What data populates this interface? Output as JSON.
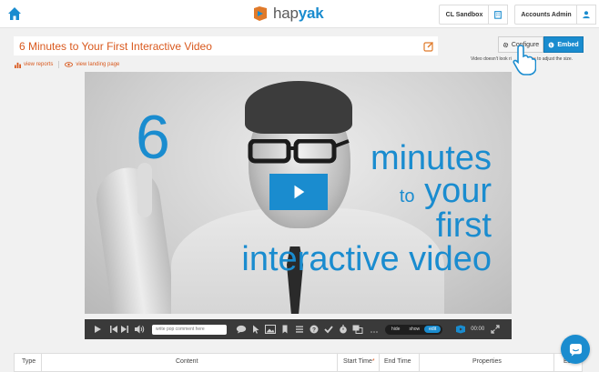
{
  "header": {
    "logo_text_hap": "hap",
    "logo_text_yak": "yak",
    "sandbox_label": "CL Sandbox",
    "account_label": "Accounts Admin"
  },
  "page": {
    "title": "6 Minutes to Your First Interactive Video",
    "links": [
      "view reports",
      "view landing page"
    ]
  },
  "actions": {
    "configure_label": "Configure",
    "embed_label": "Embed",
    "notice_prefix": "Video doesn't look ri",
    "notice_link": "here",
    "notice_suffix": " to adjust the size."
  },
  "video": {
    "big_number": "6",
    "line1": "minutes",
    "line2_small": "to",
    "line2_big": "your",
    "line3": "first",
    "line4": "interactive video"
  },
  "player": {
    "comment_placeholder": "write pop comment here",
    "segments": [
      "hide",
      "show",
      "edit"
    ],
    "active_segment": "edit",
    "time": "00:00"
  },
  "table": {
    "columns": [
      "Type",
      "Content",
      "Start Time",
      "End Time",
      "Properties",
      "Edit"
    ]
  },
  "colors": {
    "accent": "#1a8ccf",
    "title": "#d9591e"
  }
}
